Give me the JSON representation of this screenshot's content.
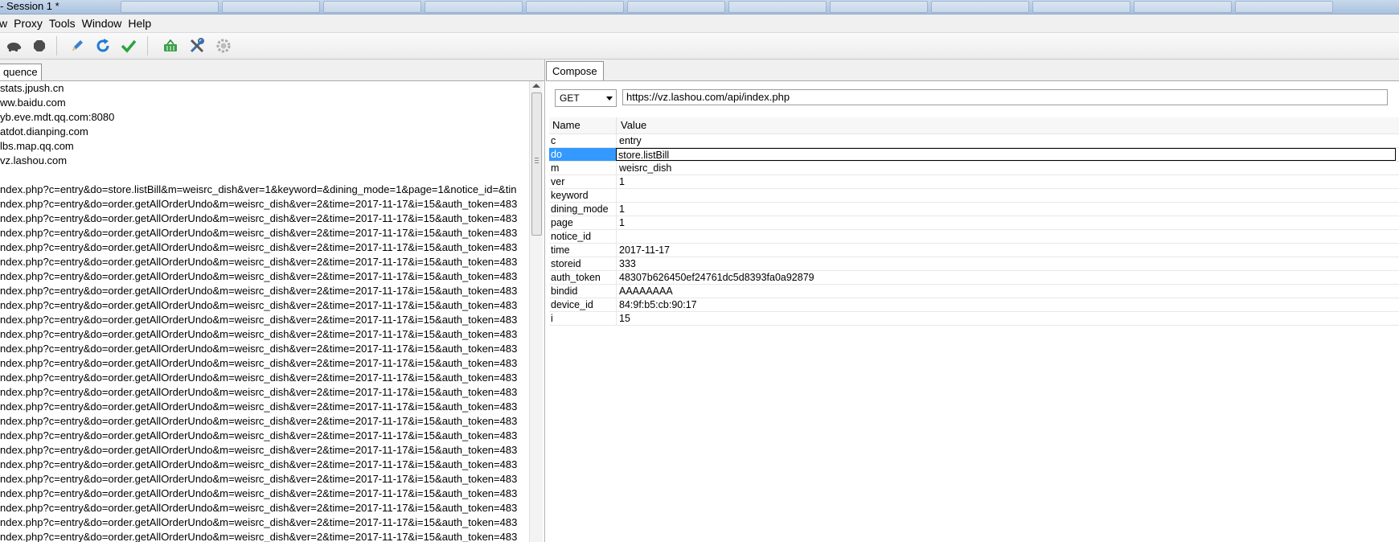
{
  "window": {
    "title": "- Session 1 *"
  },
  "menu": [
    "w",
    "Proxy",
    "Tools",
    "Window",
    "Help"
  ],
  "toolbar": {
    "icons": [
      "turtle-icon",
      "stop-icon",
      "pencil-icon",
      "refresh-icon",
      "checkmark-icon",
      "basket-icon",
      "tools-icon",
      "settings-gear-icon"
    ]
  },
  "left": {
    "tab_label": "quence",
    "rows": [
      "stats.jpush.cn",
      "ww.baidu.com",
      "yb.eve.mdt.qq.com:8080",
      "atdot.dianping.com",
      "lbs.map.qq.com",
      "vz.lashou.com",
      "",
      "ndex.php?c=entry&do=store.listBill&m=weisrc_dish&ver=1&keyword=&dining_mode=1&page=1&notice_id=&tin",
      "ndex.php?c=entry&do=order.getAllOrderUndo&m=weisrc_dish&ver=2&time=2017-11-17&i=15&auth_token=483",
      "ndex.php?c=entry&do=order.getAllOrderUndo&m=weisrc_dish&ver=2&time=2017-11-17&i=15&auth_token=483",
      "ndex.php?c=entry&do=order.getAllOrderUndo&m=weisrc_dish&ver=2&time=2017-11-17&i=15&auth_token=483",
      "ndex.php?c=entry&do=order.getAllOrderUndo&m=weisrc_dish&ver=2&time=2017-11-17&i=15&auth_token=483",
      "ndex.php?c=entry&do=order.getAllOrderUndo&m=weisrc_dish&ver=2&time=2017-11-17&i=15&auth_token=483",
      "ndex.php?c=entry&do=order.getAllOrderUndo&m=weisrc_dish&ver=2&time=2017-11-17&i=15&auth_token=483",
      "ndex.php?c=entry&do=order.getAllOrderUndo&m=weisrc_dish&ver=2&time=2017-11-17&i=15&auth_token=483",
      "ndex.php?c=entry&do=order.getAllOrderUndo&m=weisrc_dish&ver=2&time=2017-11-17&i=15&auth_token=483",
      "ndex.php?c=entry&do=order.getAllOrderUndo&m=weisrc_dish&ver=2&time=2017-11-17&i=15&auth_token=483",
      "ndex.php?c=entry&do=order.getAllOrderUndo&m=weisrc_dish&ver=2&time=2017-11-17&i=15&auth_token=483",
      "ndex.php?c=entry&do=order.getAllOrderUndo&m=weisrc_dish&ver=2&time=2017-11-17&i=15&auth_token=483",
      "ndex.php?c=entry&do=order.getAllOrderUndo&m=weisrc_dish&ver=2&time=2017-11-17&i=15&auth_token=483",
      "ndex.php?c=entry&do=order.getAllOrderUndo&m=weisrc_dish&ver=2&time=2017-11-17&i=15&auth_token=483",
      "ndex.php?c=entry&do=order.getAllOrderUndo&m=weisrc_dish&ver=2&time=2017-11-17&i=15&auth_token=483",
      "ndex.php?c=entry&do=order.getAllOrderUndo&m=weisrc_dish&ver=2&time=2017-11-17&i=15&auth_token=483",
      "ndex.php?c=entry&do=order.getAllOrderUndo&m=weisrc_dish&ver=2&time=2017-11-17&i=15&auth_token=483",
      "ndex.php?c=entry&do=order.getAllOrderUndo&m=weisrc_dish&ver=2&time=2017-11-17&i=15&auth_token=483",
      "ndex.php?c=entry&do=order.getAllOrderUndo&m=weisrc_dish&ver=2&time=2017-11-17&i=15&auth_token=483",
      "ndex.php?c=entry&do=order.getAllOrderUndo&m=weisrc_dish&ver=2&time=2017-11-17&i=15&auth_token=483",
      "ndex.php?c=entry&do=order.getAllOrderUndo&m=weisrc_dish&ver=2&time=2017-11-17&i=15&auth_token=483",
      "ndex.php?c=entry&do=order.getAllOrderUndo&m=weisrc_dish&ver=2&time=2017-11-17&i=15&auth_token=483",
      "ndex.php?c=entry&do=order.getAllOrderUndo&m=weisrc_dish&ver=2&time=2017-11-17&i=15&auth_token=483",
      "ndex.php?c=entry&do=order.getAllOrderUndo&m=weisrc_dish&ver=2&time=2017-11-17&i=15&auth_token=483",
      "ndex.php?c=entry&do=order.getAllOrderUndo&m=weisrc_dish&ver=2&time=2017-11-17&i=15&auth_token=483"
    ]
  },
  "compose": {
    "tab_label": "Compose",
    "method": "GET",
    "url": "https://vz.lashou.com/api/index.php",
    "columns": {
      "name": "Name",
      "value": "Value"
    },
    "params": [
      {
        "name": "c",
        "value": "entry"
      },
      {
        "name": "do",
        "value": "store.listBill"
      },
      {
        "name": "m",
        "value": "weisrc_dish"
      },
      {
        "name": "ver",
        "value": "1"
      },
      {
        "name": "keyword",
        "value": ""
      },
      {
        "name": "dining_mode",
        "value": "1"
      },
      {
        "name": "page",
        "value": "1"
      },
      {
        "name": "notice_id",
        "value": ""
      },
      {
        "name": "time",
        "value": "2017-11-17"
      },
      {
        "name": "storeid",
        "value": "333"
      },
      {
        "name": "auth_token",
        "value": "48307b626450ef24761dc5d8393fa0a92879"
      },
      {
        "name": "bindid",
        "value": "AAAAAAAA"
      },
      {
        "name": "device_id",
        "value": "84:9f:b5:cb:90:17"
      },
      {
        "name": "i",
        "value": "15"
      }
    ],
    "selected_param": "do"
  }
}
